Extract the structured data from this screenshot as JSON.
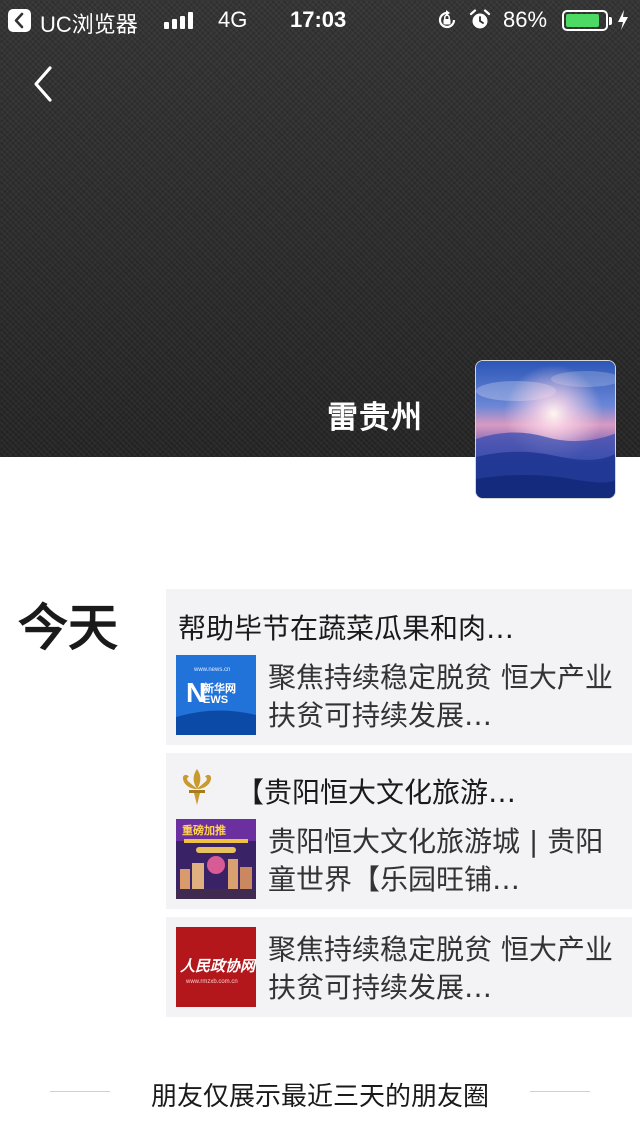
{
  "status_bar": {
    "back_app": "UC浏览器",
    "network": "4G",
    "time": "17:03",
    "battery": "86%",
    "battery_level": 0.86,
    "colors": {
      "battery": "#4cd964"
    }
  },
  "profile": {
    "name": "雷贵州"
  },
  "feed": {
    "day_label": "今天",
    "posts": [
      {
        "title": "帮助毕节在蔬菜瓜果和肉…",
        "link_text": "聚焦持续稳定脱贫 恒大产业扶贫可持续发展…",
        "thumb_text": "新华网",
        "thumb_icon": "news-thumbnail"
      },
      {
        "title": "【贵阳恒大文化旅游…",
        "title_icon": "fleur-de-lis-icon",
        "link_text": "贵阳恒大文化旅游城 | 贵阳童世界【乐园旺铺…",
        "thumb_text": "重磅加推",
        "thumb_icon": "promo-thumbnail"
      },
      {
        "link_text": "聚焦持续稳定脱贫 恒大产业扶贫可持续发展…",
        "thumb_text": "人民政协网",
        "thumb_icon": "cppcc-thumbnail"
      }
    ]
  },
  "footer": {
    "text": "朋友仅展示最近三天的朋友圈"
  }
}
